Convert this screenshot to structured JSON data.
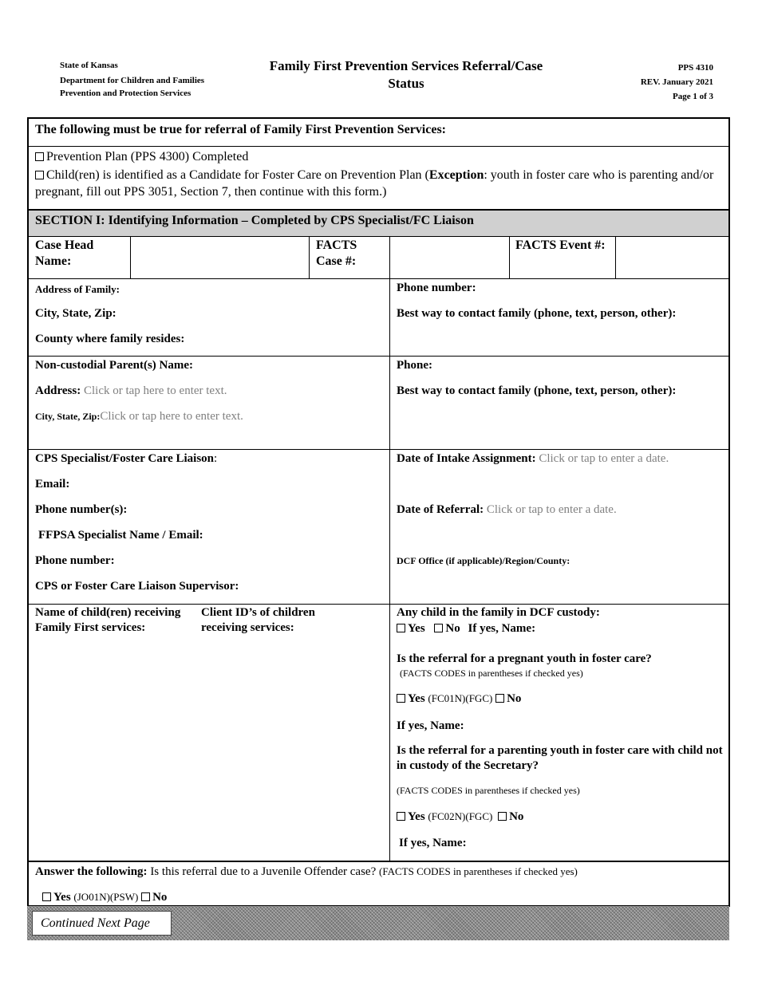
{
  "header": {
    "agency_lines": [
      "State of Kansas",
      "Department for Children and Families",
      "Prevention and Protection Services"
    ],
    "title_line1": "Family First Prevention Services Referral/Case",
    "title_line2": "Status",
    "form_number": "PPS 4310",
    "revision": "REV. January 2021",
    "page": "Page 1 of 3"
  },
  "requirements": {
    "heading": "The following must be true for referral of Family First Prevention Services:",
    "item1": "Prevention Plan (PPS 4300) Completed",
    "item2_pre": "Child(ren) is identified as a Candidate for Foster Care on Prevention Plan (",
    "item2_bold": "Exception",
    "item2_post": ": youth in foster care who is parenting and/or pregnant, fill out PPS 3051, Section 7, then continue with this form.)"
  },
  "section1": {
    "heading": "SECTION I: Identifying Information – Completed by CPS Specialist/FC Liaison",
    "case_head_label": "Case Head Name:",
    "case_head_value": "",
    "facts_case_label": "FACTS Case #:",
    "facts_case_value": "",
    "facts_event_label": "FACTS Event #:",
    "facts_event_value": "",
    "address_family": "Address of Family:",
    "city_state_zip": "City, State, Zip:",
    "county": "County where family resides:",
    "phone_number": "Phone number:",
    "best_way": "Best way to contact family (phone, text, person, other):",
    "noncustodial_name": "Non-custodial Parent(s) Name:",
    "nc_address_label": "Address:",
    "nc_address_placeholder": "Click or tap here to enter text.",
    "nc_csz_label": "City, State, Zip:",
    "nc_csz_placeholder": "Click or tap here to enter text.",
    "nc_phone": "Phone:",
    "nc_best_way": "Best way to contact family (phone, text, person, other):",
    "cps_liaison": "CPS Specialist/Foster Care Liaison",
    "cps_liaison_colon": ":",
    "email": "Email:",
    "phone_numbers": "Phone number(s):",
    "ffpsa_specialist": "FFPSA Specialist Name / Email:",
    "ffpsa_phone": "Phone number:",
    "supervisor": "CPS or Foster Care Liaison Supervisor:",
    "intake_label": "Date of Intake Assignment:",
    "intake_placeholder": "Click or tap to enter a date.",
    "referral_label": "Date of Referral:",
    "referral_placeholder": "Click or tap to enter a date.",
    "dcf_office": "DCF Office (if applicable)/Region/County:",
    "children_names": "Name of child(ren) receiving Family First services:",
    "client_ids": "Client ID’s of children receiving services:",
    "dcf_custody_q": "Any child in the family in DCF custody:",
    "yes": "Yes",
    "no": "No",
    "if_yes_name_inline": "If yes, Name:",
    "pregnant_q": "Is the referral for a pregnant youth in foster care?",
    "facts_codes_note": "(FACTS CODES in parentheses if checked yes)",
    "pregnant_code": "(FC01N)(FGC)",
    "if_yes_name": "If yes, Name:",
    "parenting_q": "Is the referral for a parenting youth in foster care with child not in custody of the Secretary?",
    "parenting_code": "(FC02N)(FGC)",
    "juvenile_bold": "Answer the following:",
    "juvenile_q": " Is this referral due to a Juvenile Offender case? ",
    "juvenile_note": "(FACTS CODES in parentheses if checked yes)",
    "juvenile_code": "(JO01N)(PSW)"
  },
  "footer": {
    "continued": "Continued Next Page"
  }
}
